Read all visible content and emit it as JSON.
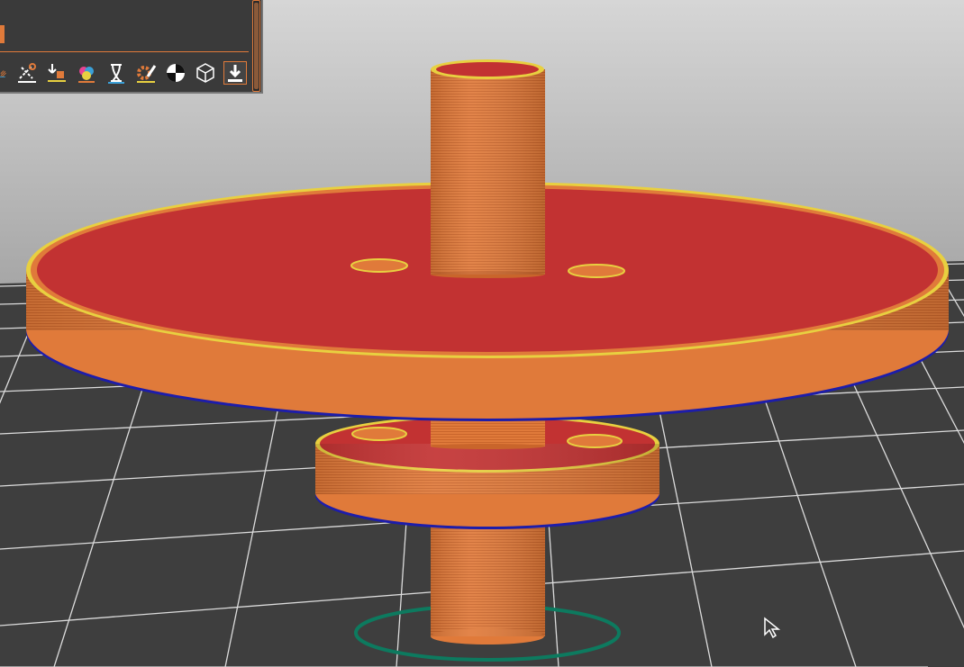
{
  "app": {
    "view": "preview-3d",
    "colors": {
      "background_top": "#c8c8c8",
      "background_bottom": "#9c9c9c",
      "bed": "#3f3f3f",
      "grid": "#e6e6e6",
      "perimeter": "#e07a3a",
      "top_solid_infill": "#c23232",
      "external_perimeter": "#e8d040",
      "skirt": "#1d1daa",
      "wipe_tower_outline": "#0d7a5f",
      "toolbar_bg": "#3a3a3a",
      "accent": "#e07a3a"
    }
  },
  "toolbar": {
    "icons": [
      {
        "name": "infill-icon"
      },
      {
        "name": "cut-icon"
      },
      {
        "name": "support-paint-icon"
      },
      {
        "name": "seam-paint-icon"
      },
      {
        "name": "mmu-paint-icon"
      },
      {
        "name": "variable-layer-height-icon"
      },
      {
        "name": "settings-icon"
      },
      {
        "name": "measure-icon"
      },
      {
        "name": "view-icon"
      },
      {
        "name": "export-icon"
      }
    ],
    "active_index": 9
  }
}
